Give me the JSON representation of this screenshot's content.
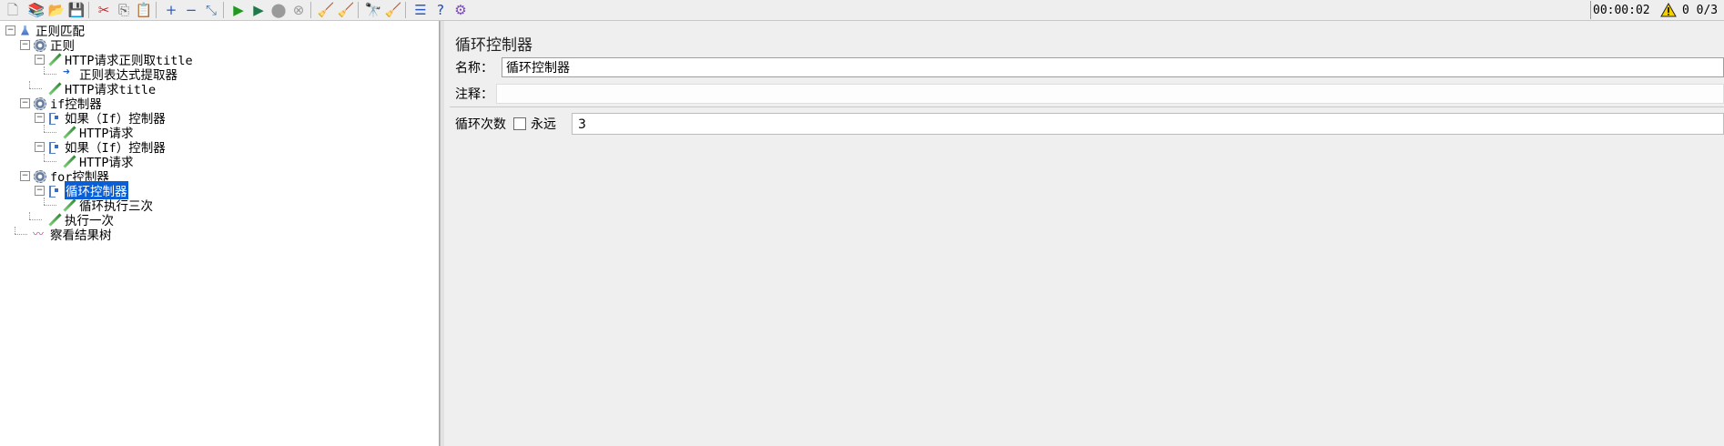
{
  "toolbar": {
    "buttons": [
      {
        "name": "new-icon",
        "glyph": "🗋",
        "color": "#888888"
      },
      {
        "name": "templates-icon",
        "glyph": "📚",
        "color": "#3a7d3a"
      },
      {
        "name": "open-icon",
        "glyph": "📂",
        "color": "#d8a12a"
      },
      {
        "name": "save-icon",
        "glyph": "💾",
        "color": "#3a5a9a"
      },
      {
        "name": "cut-icon",
        "glyph": "✂",
        "color": "#c22a2a"
      },
      {
        "name": "copy-icon",
        "glyph": "⎘",
        "color": "#666666"
      },
      {
        "name": "paste-icon",
        "glyph": "📋",
        "color": "#8a6a2a"
      },
      {
        "name": "expand-icon",
        "glyph": "+",
        "color": "#2a5ac2"
      },
      {
        "name": "collapse-icon",
        "glyph": "−",
        "color": "#2a5ac2"
      },
      {
        "name": "toggle-icon",
        "glyph": "⤡",
        "color": "#4a7ab8"
      },
      {
        "name": "start-icon",
        "glyph": "▶",
        "color": "#1e9a1e"
      },
      {
        "name": "start-no-pauses-icon",
        "glyph": "▶",
        "color": "#1e7a4a"
      },
      {
        "name": "stop-icon",
        "glyph": "⬤",
        "color": "#9a9a9a"
      },
      {
        "name": "shutdown-icon",
        "glyph": "⊗",
        "color": "#9a9a9a"
      },
      {
        "name": "clear-icon",
        "glyph": "🧹",
        "color": "#9a8a4a"
      },
      {
        "name": "clear-all-icon",
        "glyph": "🧹",
        "color": "#8a7a3a"
      },
      {
        "name": "search-icon",
        "glyph": "🔭",
        "color": "#333333"
      },
      {
        "name": "reset-search-icon",
        "glyph": "🧹",
        "color": "#d8a12a"
      },
      {
        "name": "function-helper-icon",
        "glyph": "☰",
        "color": "#2a5ac2"
      },
      {
        "name": "help-icon",
        "glyph": "?",
        "color": "#1a4ac2"
      },
      {
        "name": "remote-icon",
        "glyph": "⚙",
        "color": "#7a4ab8"
      }
    ],
    "timer": "00:00:02",
    "warning_icon": "warning-icon",
    "thread_count": "0 0/3"
  },
  "tree": [
    {
      "label": "正则匹配",
      "icon": "flask",
      "level": 0,
      "expander": "⊟"
    },
    {
      "label": "正则",
      "icon": "gear",
      "level": 1,
      "expander": "⊟"
    },
    {
      "label": "HTTP请求正则取title",
      "icon": "pen",
      "level": 2,
      "expander": "⊟"
    },
    {
      "label": "正则表达式提取器",
      "icon": "arrow",
      "level": 3,
      "expander": ""
    },
    {
      "label": "HTTP请求title",
      "icon": "pen",
      "level": 2,
      "expander": ""
    },
    {
      "label": "if控制器",
      "icon": "gear",
      "level": 1,
      "expander": "⊟"
    },
    {
      "label": "如果（If）控制器",
      "icon": "ctrl",
      "level": 2,
      "expander": "⊟"
    },
    {
      "label": "HTTP请求",
      "icon": "pen",
      "level": 3,
      "expander": ""
    },
    {
      "label": "如果（If）控制器",
      "icon": "ctrl",
      "level": 2,
      "expander": "⊟"
    },
    {
      "label": "HTTP请求",
      "icon": "pen",
      "level": 3,
      "expander": ""
    },
    {
      "label": "for控制器",
      "icon": "gear",
      "level": 1,
      "expander": "⊟"
    },
    {
      "label": "循环控制器",
      "icon": "ctrl",
      "level": 2,
      "expander": "⊟",
      "selected": true
    },
    {
      "label": "循环执行三次",
      "icon": "pen",
      "level": 3,
      "expander": ""
    },
    {
      "label": "执行一次",
      "icon": "pen",
      "level": 2,
      "expander": ""
    },
    {
      "label": "察看结果树",
      "icon": "graph",
      "level": 1,
      "expander": ""
    }
  ],
  "panel": {
    "title": "循环控制器",
    "name_label": "名称：",
    "name_value": "循环控制器",
    "comment_label": "注释：",
    "comment_value": "",
    "loop_label": "循环次数",
    "forever_label": "永远",
    "forever_checked": false,
    "loop_count": "3"
  },
  "colors": {
    "selection": "#0a5fd6",
    "panel_bg": "#efefef",
    "tree_bg": "#ffffff"
  }
}
